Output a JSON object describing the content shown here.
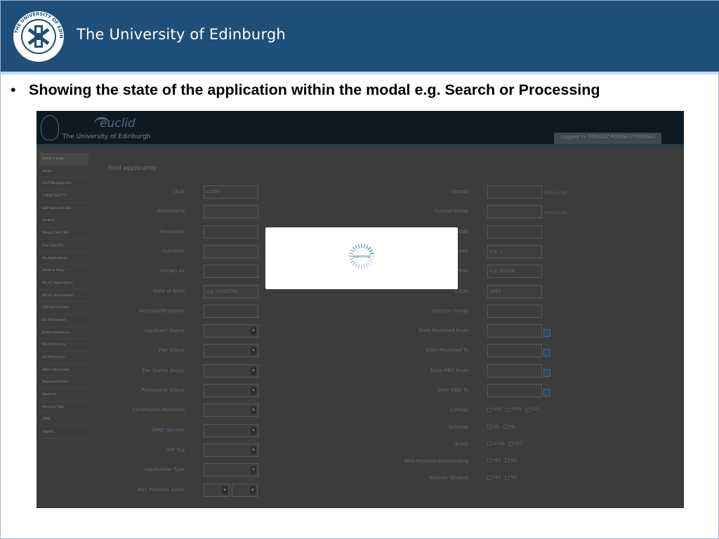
{
  "header": {
    "university_name": "The University of Edinburgh",
    "seal_text": "THE UNIVERSITY OF EDINBURGH"
  },
  "bullet": {
    "marker": "•",
    "text": "Showing the state of the application within the modal e.g. Search or Processing"
  },
  "app": {
    "brand": "euclid",
    "university": "The University of Edinburgh",
    "logged_in": "Logged in: TOMASZ POONA (TPOONA)",
    "page_title": "Find applicants",
    "sidebar": [
      "Select a page",
      "Home",
      "Conf Management",
      "***JON TEST***",
      "SSP tools and info",
      "Student",
      "Tomasz Test CPS",
      "Free Test CPS",
      "My Applications",
      "Home & Away",
      "My UG Applications",
      "My UG Applications",
      "CPS and Courses",
      "UG Admissions",
      "Direct Admissions",
      "PG Admissions",
      "VS Admissions",
      "Other Admissions",
      "Representatives",
      "Students",
      "Personal Tutor",
      "ESPS",
      "Logout"
    ],
    "left_fields": [
      {
        "label": "UUN",
        "value": "s1206",
        "type": "text"
      },
      {
        "label": "Personal Id",
        "value": "",
        "type": "text"
      },
      {
        "label": "Forename",
        "value": "",
        "type": "text"
      },
      {
        "label": "Surname",
        "value": "",
        "type": "text"
      },
      {
        "label": "Known As",
        "value": "",
        "type": "text"
      },
      {
        "label": "Date of Birth",
        "value": "e.g. 17-OCT-81",
        "type": "text"
      },
      {
        "label": "Decision/Response",
        "value": "",
        "type": "text"
      },
      {
        "label": "Applicant Status",
        "value": "",
        "type": "select"
      },
      {
        "label": "Fee Status",
        "value": "",
        "type": "select"
      },
      {
        "label": "Fee Status Group",
        "value": "",
        "type": "select"
      },
      {
        "label": "Processing Status",
        "value": "",
        "type": "select"
      },
      {
        "label": "Certificates Received",
        "value": "",
        "type": "select"
      },
      {
        "label": "SIMD Quintile",
        "value": "",
        "type": "select"
      },
      {
        "label": "WP Tag",
        "value": "",
        "type": "select"
      },
      {
        "label": "Application Type",
        "value": "",
        "type": "select"
      },
      {
        "label": "Mini Portfolio Score",
        "value": "",
        "type": "range"
      }
    ],
    "right_fields": [
      {
        "label": "School",
        "value": "",
        "hint": "Refresh list"
      },
      {
        "label": "Course Group",
        "value": "",
        "hint": "Refresh list"
      },
      {
        "label": "Code",
        "value": "",
        "hint": ""
      },
      {
        "label": "Entry",
        "value": "e.g. 1...",
        "hint": ""
      },
      {
        "label": "Year",
        "value": "e.g. 2015/6...",
        "hint": ""
      },
      {
        "label": "Cycle",
        "value": "2015",
        "hint": ""
      },
      {
        "label": "Selector Group",
        "value": "",
        "hint": ""
      },
      {
        "label": "Date Received From",
        "value": "",
        "hint": "",
        "calendar": true
      },
      {
        "label": "Date Received To",
        "value": "",
        "hint": "",
        "calendar": true
      },
      {
        "label": "Date RBD From",
        "value": "",
        "hint": "",
        "calendar": true
      },
      {
        "label": "Date RBD To",
        "value": "",
        "hint": "",
        "calendar": true
      }
    ],
    "right_options": [
      {
        "label": "College",
        "options": [
          "HSS",
          "MVM",
          "SCE"
        ]
      },
      {
        "label": "Scheme",
        "options": [
          "UG",
          "PG"
        ]
      },
      {
        "label": "Entry",
        "options": [
          "UCAS",
          "UTT"
        ]
      },
      {
        "label": "Mini Portfolio Outstanding",
        "options": [
          "YES",
          "NO"
        ]
      },
      {
        "label": "Mature Student",
        "options": [
          "YES",
          "NO"
        ]
      }
    ],
    "modal": {
      "status_text": "searching"
    }
  }
}
